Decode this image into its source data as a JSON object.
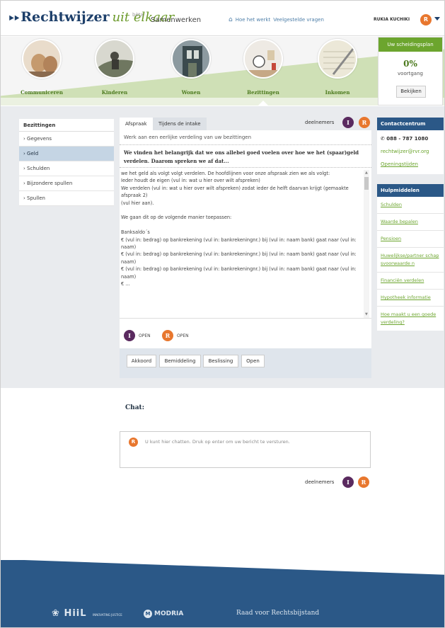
{
  "header": {
    "logo_mark": "⯈⯈",
    "logo_strong": "Rechtwijzer",
    "logo_italic": "uit elkaar",
    "beta": "bèta",
    "section": "Samenwerken",
    "nav_how": "Hoe het werkt",
    "nav_faq": "Veelgestelde vragen",
    "user_name": "RUKIA KUCHIKI",
    "user_initial": "R"
  },
  "categories": [
    {
      "label": "Communiceren",
      "active": false
    },
    {
      "label": "Kinderen",
      "active": false
    },
    {
      "label": "Wonen",
      "active": false
    },
    {
      "label": "Bezittingen",
      "active": true
    },
    {
      "label": "Inkomen",
      "active": false
    }
  ],
  "plan": {
    "title": "Uw scheidingsplan",
    "percent": "0%",
    "progress_label": "voortgang",
    "progress_value": 0,
    "view_button": "Bekijken"
  },
  "sidebar": {
    "heading": "Bezittingen",
    "items": [
      {
        "label": "› Gegevens",
        "active": false
      },
      {
        "label": "› Geld",
        "active": true
      },
      {
        "label": "› Schulden",
        "active": false
      },
      {
        "label": "› Bijzondere spullen",
        "active": false
      },
      {
        "label": "› Spullen",
        "active": false
      }
    ]
  },
  "center": {
    "tabs": [
      "Afspraak",
      "Tijdens de intake"
    ],
    "participants_label": "deelnemers",
    "participant_1": "I",
    "participant_2": "R",
    "subtitle": "Werk aan een eerlijke verdeling van uw bezittingen",
    "intro": "We vinden het belangrijk dat we ons allebei goed voelen over hoe we het (spaar)geld verdelen. Daarom spreken we af dat...",
    "agreement_text": "we het geld als volgt volgt verdelen. De hoofdlijnen voor onze afspraak zien we als volgt:\nIeder houdt de eigen (vul in: wat u hier over wilt afspreken)\nWe verdelen (vul in: wat u hier over wilt afspreken) zodat ieder de helft daarvan krijgt (gemaakte afspraak 2)\n(vul hier aan).\n\nWe gaan dit op de volgende manier toepassen:\n\nBanksaldo´s\n€ (vul in: bedrag) op bankrekening (vul in: bankrekeningnr.) bij (vul in: naam bank) gaat naar (vul in: naam)\n€ (vul in: bedrag) op bankrekening (vul in: bankrekeningnr.) bij (vul in: naam bank) gaat naar (vul in: naam)\n€ (vul in: bedrag) op bankrekening (vul in: bankrekeningnr.) bij (vul in: naam bank) gaat naar (vul in: naam)\n€ ...",
    "status": [
      {
        "initial": "I",
        "label": "OPEN"
      },
      {
        "initial": "R",
        "label": "OPEN"
      }
    ],
    "buttons": [
      "Akkoord",
      "Bemiddeling",
      "Beslissing",
      "Open"
    ]
  },
  "contact": {
    "heading": "Contactcentrum",
    "phone": "✆ 088 - 787 1080",
    "email": "rechtwijzer@rvr.org",
    "hours": "Openingstijden"
  },
  "tools": {
    "heading": "Hulpmiddelen",
    "items": [
      "Schulden",
      "Waarde bepalen",
      "Pensioen",
      "Huwelijkse/partner schapsvoorwaarde n",
      "Financiën verdelen",
      "Hypotheek informatie",
      "Hoe maakt u een goede verdeling?"
    ]
  },
  "chat": {
    "title": "Chat:",
    "initial": "R",
    "placeholder": "U kunt hier chatten. Druk op enter om uw bericht te versturen.",
    "participants_label": "deelnemers",
    "participant_1": "I",
    "participant_2": "R"
  },
  "footer": {
    "hiil": "HiiL",
    "hiil_small": "INNOVATING JUSTICE",
    "modria": "MODRIA",
    "raad": "Raad voor Rechtsbijstand"
  },
  "colors": {
    "navy": "#1d3f6a",
    "green": "#6ca52e",
    "orange": "#e8772e",
    "purple": "#5a2a5f",
    "footer_blue": "#2b5887"
  }
}
